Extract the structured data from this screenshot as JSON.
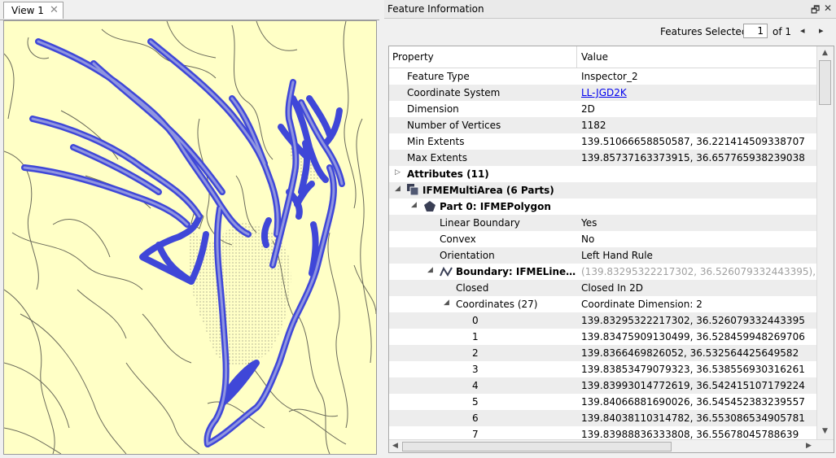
{
  "view": {
    "tab_label": "View 1",
    "tab_close": "✕"
  },
  "panel": {
    "title": "Feature Information",
    "float_icon": "🗗",
    "close_icon": "✕",
    "features_selected_label": "Features Selected:",
    "features_selected_value": "1",
    "of_label": "of 1",
    "prev_icon": "◂",
    "next_icon": "▸"
  },
  "grid": {
    "columns": [
      "Property",
      "Value"
    ],
    "rows": [
      {
        "property": "Feature Type",
        "value": "Inspector_2"
      },
      {
        "property": "Coordinate System",
        "value": "LL-JGD2K"
      },
      {
        "property": "Dimension",
        "value": "2D"
      },
      {
        "property": "Number of Vertices",
        "value": "1182"
      },
      {
        "property": "Min Extents",
        "value": "139.51066658850587, 36.221414509338707"
      },
      {
        "property": "Max Extents",
        "value": "139.85737163373915, 36.657765938239038"
      },
      {
        "property": "Attributes (11)",
        "value": ""
      },
      {
        "property": "IFMEMultiArea (6 Parts)",
        "value": ""
      },
      {
        "property": "Part 0: IFMEPolygon",
        "value": ""
      },
      {
        "property": "Linear Boundary",
        "value": "Yes"
      },
      {
        "property": "Convex",
        "value": "No"
      },
      {
        "property": "Orientation",
        "value": "Left Hand Rule"
      },
      {
        "property": "Boundary: IFMELine…",
        "value": "(139.83295322217302, 36.526079332443395), ..."
      },
      {
        "property": "Closed",
        "value": "Closed In 2D"
      },
      {
        "property": "Coordinates (27)",
        "value": "Coordinate Dimension: 2"
      },
      {
        "property": "0",
        "value": "139.83295322217302, 36.526079332443395"
      },
      {
        "property": "1",
        "value": "139.83475909130499, 36.528459948269706"
      },
      {
        "property": "2",
        "value": "139.8366469826052, 36.532564425649582"
      },
      {
        "property": "3",
        "value": "139.83853479079323, 36.538556930316261"
      },
      {
        "property": "4",
        "value": "139.83993014772619, 36.542415107179224"
      },
      {
        "property": "5",
        "value": "139.84066881690026, 36.545452383239557"
      },
      {
        "property": "6",
        "value": "139.84038110314782, 36.553086534905781"
      },
      {
        "property": "7",
        "value": "139.83988836333808, 36.55678045788639"
      }
    ]
  },
  "colors": {
    "map_bg": "#ffffc6",
    "feature_outline": "#4a52e6",
    "feature_fill": "#7f86d6"
  }
}
